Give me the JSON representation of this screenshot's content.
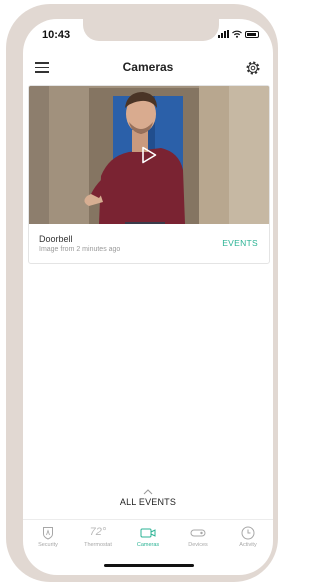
{
  "status_bar": {
    "time": "10:43"
  },
  "header": {
    "title": "Cameras"
  },
  "camera_card": {
    "name": "Doorbell",
    "subtitle": "Image from 2 minutes ago",
    "events_label": "EVENTS"
  },
  "all_events": {
    "label": "ALL EVENTS"
  },
  "tabs": [
    {
      "label": "Security",
      "icon": "shield-icon"
    },
    {
      "label": "Thermostat",
      "icon": "thermostat-icon",
      "value": "72°"
    },
    {
      "label": "Cameras",
      "icon": "camera-icon",
      "active": true
    },
    {
      "label": "Devices",
      "icon": "devices-icon"
    },
    {
      "label": "Activity",
      "icon": "clock-icon"
    }
  ],
  "colors": {
    "accent": "#2bb394",
    "frame": "#e1d8d2"
  }
}
